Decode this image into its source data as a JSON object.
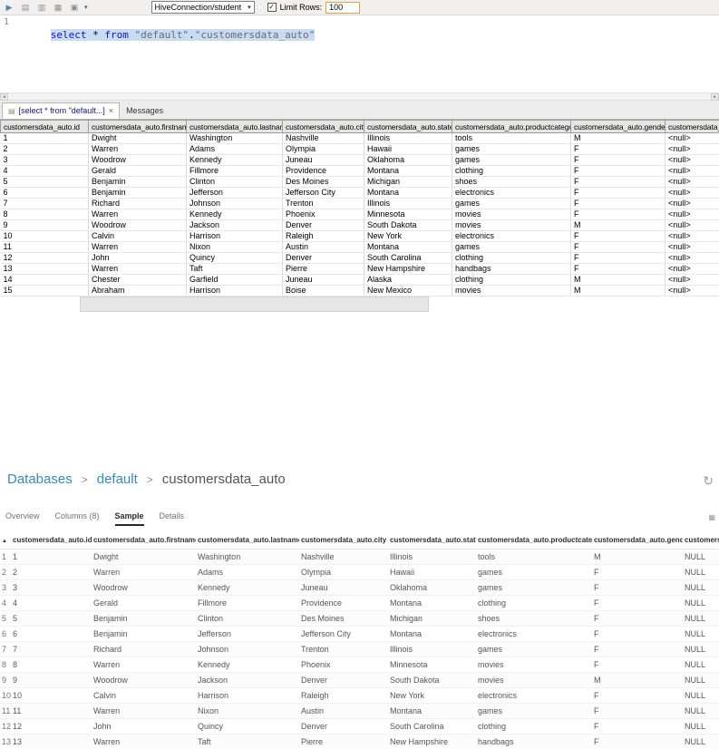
{
  "sql_tool": {
    "toolbar": {
      "icons": {
        "run": "▶",
        "open": "▤",
        "save": "▥",
        "export": "▦",
        "settings": "▣",
        "caret": "▾"
      },
      "connection": "HiveConnection/student",
      "checkbox_check": "✓",
      "limit_rows_label": "Limit Rows:",
      "limit_rows_value": "100"
    },
    "editor": {
      "line_number": "1",
      "segments": [
        {
          "text": "select",
          "type": "keyword"
        },
        {
          "text": " * ",
          "type": "plain"
        },
        {
          "text": "from",
          "type": "keyword"
        },
        {
          "text": " ",
          "type": "plain"
        },
        {
          "text": "\"default\"",
          "type": "identifier"
        },
        {
          "text": ".",
          "type": "plain"
        },
        {
          "text": "\"customersdata_auto\"",
          "type": "identifier"
        }
      ]
    },
    "scrollbar": {
      "left_icon": "◂",
      "right_icon": "▸"
    },
    "tabs": {
      "result_icon": "▤",
      "result_label": "[select * from \"default...]",
      "close_icon": "×",
      "messages_label": "Messages"
    },
    "results": {
      "columns": [
        "customersdata_auto.id",
        "customersdata_auto.firstname",
        "customersdata_auto.lastname",
        "customersdata_auto.city",
        "customersdata_auto.state",
        "customersdata_auto.productcategory",
        "customersdata_auto.gender",
        "customersdata_a"
      ],
      "rows": [
        [
          "1",
          "Dwight",
          "Washington",
          "Nashville",
          "Illinois",
          "tools",
          "M",
          "<null>"
        ],
        [
          "2",
          "Warren",
          "Adams",
          "Olympia",
          "Hawaii",
          "games",
          "F",
          "<null>"
        ],
        [
          "3",
          "Woodrow",
          "Kennedy",
          "Juneau",
          "Oklahoma",
          "games",
          "F",
          "<null>"
        ],
        [
          "4",
          "Gerald",
          "Fillmore",
          "Providence",
          "Montana",
          "clothing",
          "F",
          "<null>"
        ],
        [
          "5",
          "Benjamin",
          "Clinton",
          "Des Moines",
          "Michigan",
          "shoes",
          "F",
          "<null>"
        ],
        [
          "6",
          "Benjamin",
          "Jefferson",
          "Jefferson City",
          "Montana",
          "electronics",
          "F",
          "<null>"
        ],
        [
          "7",
          "Richard",
          "Johnson",
          "Trenton",
          "Illinois",
          "games",
          "F",
          "<null>"
        ],
        [
          "8",
          "Warren",
          "Kennedy",
          "Phoenix",
          "Minnesota",
          "movies",
          "F",
          "<null>"
        ],
        [
          "9",
          "Woodrow",
          "Jackson",
          "Denver",
          "South Dakota",
          "movies",
          "M",
          "<null>"
        ],
        [
          "10",
          "Calvin",
          "Harrison",
          "Raleigh",
          "New York",
          "electronics",
          "F",
          "<null>"
        ],
        [
          "11",
          "Warren",
          "Nixon",
          "Austin",
          "Montana",
          "games",
          "F",
          "<null>"
        ],
        [
          "12",
          "John",
          "Quincy",
          "Denver",
          "South Carolina",
          "clothing",
          "F",
          "<null>"
        ],
        [
          "13",
          "Warren",
          "Taft",
          "Pierre",
          "New Hampshire",
          "handbags",
          "F",
          "<null>"
        ],
        [
          "14",
          "Chester",
          "Garfield",
          "Juneau",
          "Alaska",
          "clothing",
          "M",
          "<null>"
        ],
        [
          "15",
          "Abraham",
          "Harrison",
          "Boise",
          "New Mexico",
          "movies",
          "M",
          "<null>"
        ]
      ]
    }
  },
  "hue": {
    "breadcrumb": {
      "items": [
        "Databases",
        "default",
        "customersdata_auto"
      ],
      "separator": ">"
    },
    "refresh_icon": "↻",
    "tabs": [
      "Overview",
      "Columns (8)",
      "Sample",
      "Details"
    ],
    "active_tab": "Sample",
    "export_icon": "▦",
    "sort_icon": "▲",
    "table": {
      "columns": [
        "customersdata_auto.id",
        "customersdata_auto.firstname",
        "customersdata_auto.lastname",
        "customersdata_auto.city",
        "customersdata_auto.state",
        "customersdata_auto.productcategory",
        "customersdata_auto.gender",
        "customers"
      ],
      "rows": [
        [
          "1",
          "1",
          "Dwight",
          "Washington",
          "Nashville",
          "Illinois",
          "tools",
          "M",
          "NULL"
        ],
        [
          "2",
          "2",
          "Warren",
          "Adams",
          "Olympia",
          "Hawaii",
          "games",
          "F",
          "NULL"
        ],
        [
          "3",
          "3",
          "Woodrow",
          "Kennedy",
          "Juneau",
          "Oklahoma",
          "games",
          "F",
          "NULL"
        ],
        [
          "4",
          "4",
          "Gerald",
          "Fillmore",
          "Providence",
          "Montana",
          "clothing",
          "F",
          "NULL"
        ],
        [
          "5",
          "5",
          "Benjamin",
          "Clinton",
          "Des Moines",
          "Michigan",
          "shoes",
          "F",
          "NULL"
        ],
        [
          "6",
          "6",
          "Benjamin",
          "Jefferson",
          "Jefferson City",
          "Montana",
          "electronics",
          "F",
          "NULL"
        ],
        [
          "7",
          "7",
          "Richard",
          "Johnson",
          "Trenton",
          "Illinois",
          "games",
          "F",
          "NULL"
        ],
        [
          "8",
          "8",
          "Warren",
          "Kennedy",
          "Phoenix",
          "Minnesota",
          "movies",
          "F",
          "NULL"
        ],
        [
          "9",
          "9",
          "Woodrow",
          "Jackson",
          "Denver",
          "South Dakota",
          "movies",
          "M",
          "NULL"
        ],
        [
          "10",
          "10",
          "Calvin",
          "Harrison",
          "Raleigh",
          "New York",
          "electronics",
          "F",
          "NULL"
        ],
        [
          "11",
          "11",
          "Warren",
          "Nixon",
          "Austin",
          "Montana",
          "games",
          "F",
          "NULL"
        ],
        [
          "12",
          "12",
          "John",
          "Quincy",
          "Denver",
          "South Carolina",
          "clothing",
          "F",
          "NULL"
        ],
        [
          "13",
          "13",
          "Warren",
          "Taft",
          "Pierre",
          "New Hampshire",
          "handbags",
          "F",
          "NULL"
        ]
      ]
    }
  }
}
